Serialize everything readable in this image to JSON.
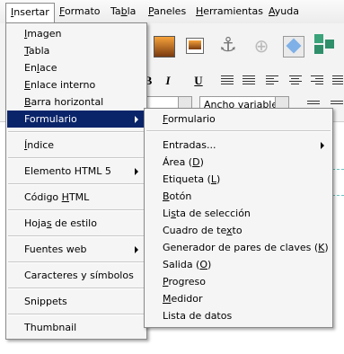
{
  "menubar": {
    "items": [
      {
        "pre": "",
        "u": "I",
        "post": "nsertar"
      },
      {
        "pre": "",
        "u": "F",
        "post": "ormato"
      },
      {
        "pre": "Ta",
        "u": "b",
        "post": "la"
      },
      {
        "pre": "",
        "u": "P",
        "post": "aneles"
      },
      {
        "pre": "",
        "u": "H",
        "post": "erramientas"
      },
      {
        "pre": "",
        "u": "A",
        "post": "yuda"
      }
    ]
  },
  "toolbar": {
    "font_select_value": "Ancho variable",
    "italic_label": "I",
    "bold_partial": "B"
  },
  "insert_menu": {
    "items": [
      {
        "pre": "",
        "u": "I",
        "post": "magen"
      },
      {
        "pre": "",
        "u": "T",
        "post": "abla"
      },
      {
        "pre": "En",
        "u": "l",
        "post": "ace"
      },
      {
        "pre": "",
        "u": "E",
        "post": "nlace interno"
      },
      {
        "pre": "",
        "u": "B",
        "post": "arra horizontal"
      },
      {
        "pre": "",
        "u": "",
        "post": "Formulario"
      },
      {
        "pre": "",
        "u": "Í",
        "post": "ndice"
      },
      {
        "pre": "",
        "u": "",
        "post": "Elemento HTML 5"
      },
      {
        "pre": "Código ",
        "u": "H",
        "post": "TML"
      },
      {
        "pre": "Hoja",
        "u": "s",
        "post": " de estilo"
      },
      {
        "pre": "",
        "u": "",
        "post": "Fuentes web"
      },
      {
        "pre": "",
        "u": "",
        "post": "Caracteres y símbolos"
      },
      {
        "pre": "",
        "u": "",
        "post": "Snippets"
      },
      {
        "pre": "",
        "u": "",
        "post": "Thumbnail"
      }
    ]
  },
  "form_submenu": {
    "items": [
      {
        "pre": "",
        "u": "F",
        "post": "ormulario"
      },
      {
        "pre": "",
        "u": "",
        "post": "Entradas..."
      },
      {
        "pre": "Área (",
        "u": "D",
        "post": ")"
      },
      {
        "pre": "Etiqueta (",
        "u": "L",
        "post": ")"
      },
      {
        "pre": "",
        "u": "B",
        "post": "otón"
      },
      {
        "pre": "Li",
        "u": "s",
        "post": "ta de selección"
      },
      {
        "pre": "Cuadro de te",
        "u": "x",
        "post": "to"
      },
      {
        "pre": "Generador de pares de claves (",
        "u": "K",
        "post": ")"
      },
      {
        "pre": "Salida (",
        "u": "O",
        "post": ")"
      },
      {
        "pre": "",
        "u": "P",
        "post": "rogreso"
      },
      {
        "pre": "",
        "u": "M",
        "post": "edidor"
      },
      {
        "pre": "Lista de datos",
        "u": "",
        "post": ""
      }
    ]
  },
  "colors": {
    "highlight": "#0a246a",
    "menu_bg": "#f5f5f5"
  }
}
